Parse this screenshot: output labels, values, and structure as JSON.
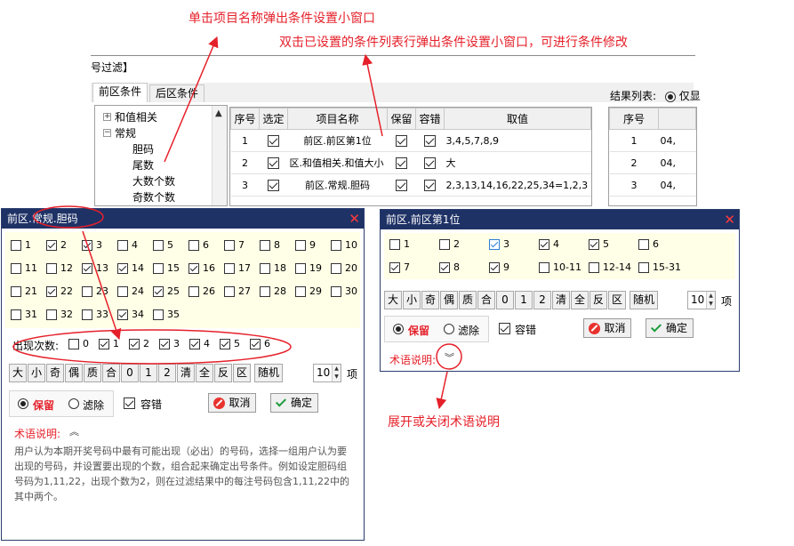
{
  "annotations": {
    "top1": "单击项目名称弹出条件设置小窗口",
    "top2": "双击已设置的条件列表行弹出条件设置小窗口，可进行条件修改",
    "bottom": "展开或关闭术语说明"
  },
  "main_window": {
    "title": "号过滤】",
    "tabs": [
      "前区条件",
      "后区条件"
    ],
    "tree": {
      "root1": "和值相关",
      "root2": "常规",
      "children": [
        "胆码",
        "尾数",
        "大数个数",
        "奇数个数"
      ],
      "expand_glyph": "+",
      "collapse_glyph": "−"
    },
    "conditions_table": {
      "headers": [
        "序号",
        "选定",
        "项目名称",
        "保留",
        "容错",
        "取值"
      ],
      "rows": [
        {
          "no": "1",
          "name": "前区.前区第1位",
          "value": "3,4,5,7,8,9"
        },
        {
          "no": "2",
          "name": "区.和值相关.和值大小",
          "value": "大"
        },
        {
          "no": "3",
          "name": "前区.常规.胆码",
          "value": "2,3,13,14,16,22,25,34=1,2,3"
        }
      ]
    },
    "results": {
      "label": "结果列表:",
      "option": "仅显",
      "headers": [
        "序号",
        ""
      ],
      "rows": [
        [
          "1",
          "04,"
        ],
        [
          "2",
          "04,"
        ],
        [
          "3",
          "04,"
        ]
      ]
    }
  },
  "dialog_left": {
    "title": "前区.常规.胆码",
    "close": "✕",
    "numbers": [
      "1",
      "2",
      "3",
      "4",
      "5",
      "6",
      "7",
      "8",
      "9",
      "10",
      "11",
      "12",
      "13",
      "14",
      "15",
      "16",
      "17",
      "18",
      "19",
      "20",
      "21",
      "22",
      "23",
      "24",
      "25",
      "26",
      "27",
      "28",
      "29",
      "30",
      "31",
      "32",
      "33",
      "34",
      "35"
    ],
    "checked": [
      2,
      3,
      13,
      14,
      16,
      22,
      25,
      34
    ],
    "occ_label": "出现次数:",
    "occ": [
      "0",
      "1",
      "2",
      "3",
      "4",
      "5",
      "6"
    ],
    "occ_checked": [
      "1",
      "2",
      "3",
      "4",
      "5",
      "6"
    ],
    "buttons": [
      "大",
      "小",
      "奇",
      "偶",
      "质",
      "合",
      "0",
      "1",
      "2",
      "清",
      "全",
      "反",
      "区"
    ],
    "random": "随机",
    "spin_value": "10",
    "unit": "项",
    "keep": "保留",
    "filter": "滤除",
    "tolerance": "容错",
    "cancel": "取消",
    "ok": "确定",
    "term_label": "术语说明:",
    "chevron": "︽",
    "description": "用户认为本期开奖号码中最有可能出现（必出）的号码，选择一组用户认为要出现的号码，并设置要出现的个数，组合起来确定出号条件。例如设定胆码组号码为1,11,22，出现个数为2，则在过滤结果中的每注号码包含1,11,22中的其中两个。"
  },
  "dialog_right": {
    "title": "前区.前区第1位",
    "close": "✕",
    "numbers": [
      "1",
      "2",
      "3",
      "4",
      "5",
      "6",
      "7",
      "8",
      "9",
      "10-11",
      "12-14",
      "15-31"
    ],
    "checked": [
      "3",
      "4",
      "5",
      "7",
      "8",
      "9"
    ],
    "buttons": [
      "大",
      "小",
      "奇",
      "偶",
      "质",
      "合",
      "0",
      "1",
      "2",
      "清",
      "全",
      "反",
      "区"
    ],
    "random": "随机",
    "spin_value": "10",
    "unit": "项",
    "keep": "保留",
    "filter": "滤除",
    "tolerance": "容错",
    "cancel": "取消",
    "ok": "确定",
    "term_label": "术语说明:",
    "chevron": "︾"
  },
  "colors": {
    "accent_red": "#e5202a",
    "titlebar": "#1f3266",
    "panel_yellow": "#fffee6"
  }
}
